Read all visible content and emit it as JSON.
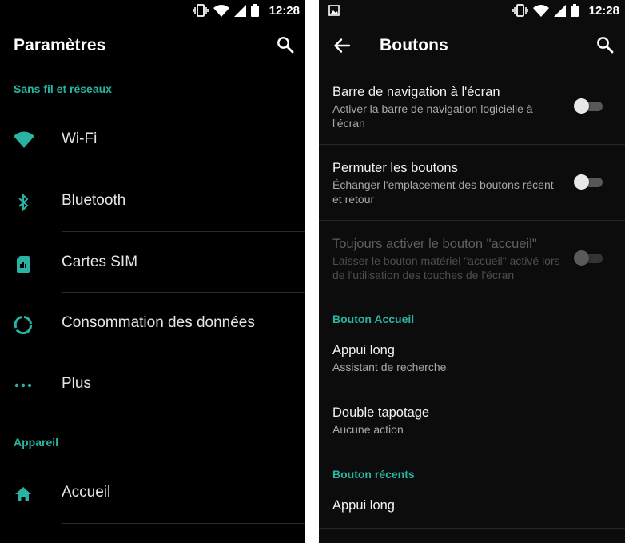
{
  "status_bar": {
    "time": "12:28"
  },
  "colors": {
    "accent": "#2ab3a2",
    "background": "#000000",
    "text": "#e6e6e6"
  },
  "left_screen": {
    "title": "Paramètres",
    "sections": [
      {
        "label": "Sans fil et réseaux",
        "items": [
          {
            "label": "Wi-Fi",
            "icon": "wifi-icon"
          },
          {
            "label": "Bluetooth",
            "icon": "bluetooth-icon"
          },
          {
            "label": "Cartes SIM",
            "icon": "sim-card-icon"
          },
          {
            "label": "Consommation des données",
            "icon": "data-usage-icon"
          },
          {
            "label": "Plus",
            "icon": "more-icon"
          }
        ]
      },
      {
        "label": "Appareil",
        "items": [
          {
            "label": "Accueil",
            "icon": "home-icon"
          }
        ]
      }
    ]
  },
  "right_screen": {
    "title": "Boutons",
    "toggles": [
      {
        "title": "Barre de navigation à l'écran",
        "subtitle": "Activer la barre de navigation logicielle à l'écran",
        "on": false,
        "enabled": true
      },
      {
        "title": "Permuter les boutons",
        "subtitle": "Échanger l'emplacement des boutons récent et retour",
        "on": false,
        "enabled": true
      },
      {
        "title": "Toujours activer le bouton \"accueil\"",
        "subtitle": "Laisser le bouton matériel \"accueil\" activé lors de l'utilisation des touches de l'écran",
        "on": false,
        "enabled": false
      }
    ],
    "home_section": {
      "label": "Bouton Accueil",
      "items": [
        {
          "title": "Appui long",
          "subtitle": "Assistant de recherche"
        },
        {
          "title": "Double tapotage",
          "subtitle": "Aucune action"
        }
      ]
    },
    "recents_section": {
      "label": "Bouton récents",
      "items": [
        {
          "title": "Appui long"
        }
      ]
    }
  }
}
